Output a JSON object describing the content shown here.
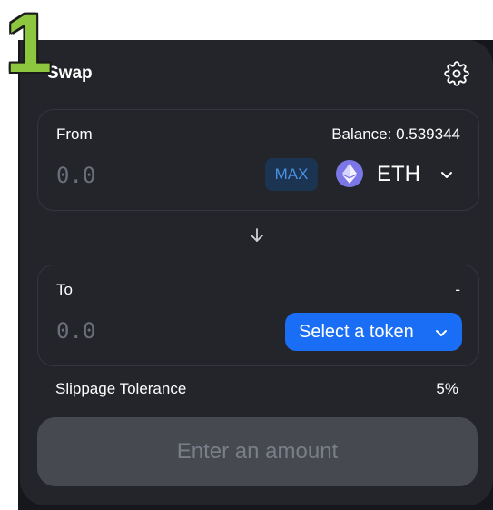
{
  "step_marker": "1",
  "header": {
    "title": "Swap",
    "settings_icon": "gear-icon"
  },
  "from_panel": {
    "label": "From",
    "balance": "Balance: 0.539344",
    "amount_placeholder": "0.0",
    "max_label": "MAX",
    "token": "ETH",
    "token_icon": "eth-icon",
    "dropdown_icon": "chevron-down-icon"
  },
  "switch_icon": "arrow-down-icon",
  "to_panel": {
    "label": "To",
    "balance": "-",
    "amount_placeholder": "0.0",
    "select_token_label": "Select a token",
    "dropdown_icon": "chevron-down-icon"
  },
  "slippage": {
    "label": "Slippage Tolerance",
    "value": "5%"
  },
  "submit": {
    "label": "Enter an amount",
    "disabled": true
  },
  "colors": {
    "background": "#23252b",
    "panel_border": "#33363e",
    "accent": "#1a6ef5",
    "max_bg": "#1b3452",
    "max_text": "#4a90e2",
    "disabled_button": "#464950",
    "step_marker": "#8dc63f"
  }
}
